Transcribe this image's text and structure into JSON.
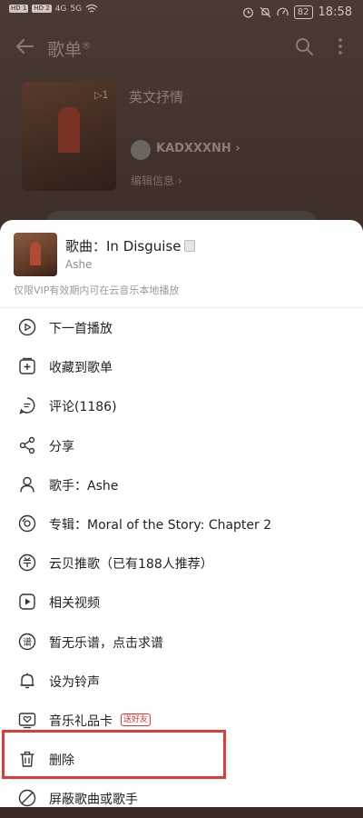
{
  "status_bar": {
    "left": [
      "HD 1",
      "HD 2",
      "4G",
      "5G"
    ],
    "battery": "82",
    "time": "18:58"
  },
  "header": {
    "title": "歌单",
    "title_mark": "®"
  },
  "playlist": {
    "track_count": "▷1",
    "name": "英文抒情",
    "creator": "KADXXXNH",
    "creator_chevron": "›",
    "edit": "编辑信息",
    "edit_chevron": "›"
  },
  "song": {
    "title": "歌曲：In Disguise",
    "artist": "Ashe",
    "note": "仅限VIP有效期内可在云音乐本地播放"
  },
  "menu": [
    {
      "label": "下一首播放",
      "icon": "play-next-icon"
    },
    {
      "label": "收藏到歌单",
      "icon": "add-to-playlist-icon"
    },
    {
      "label": "评论(1186)",
      "icon": "comment-icon"
    },
    {
      "label": "分享",
      "icon": "share-icon"
    },
    {
      "label": "歌手：Ashe",
      "icon": "artist-icon"
    },
    {
      "label": "专辑：Moral of the Story: Chapter 2",
      "icon": "album-icon"
    },
    {
      "label": "云贝推歌（已有188人推荐）",
      "icon": "recommend-icon"
    },
    {
      "label": "相关视频",
      "icon": "video-icon"
    },
    {
      "label": "暂无乐谱，点击求谱",
      "icon": "sheet-music-icon"
    },
    {
      "label": "设为铃声",
      "icon": "bell-icon"
    },
    {
      "label": "音乐礼品卡",
      "icon": "gift-card-icon",
      "tag": "送好友"
    },
    {
      "label": "删除",
      "icon": "trash-icon"
    },
    {
      "label": "屏蔽歌曲或歌手",
      "icon": "block-icon"
    }
  ],
  "colors": {
    "highlight": "#e53935",
    "tag_red": "#e0372c"
  }
}
